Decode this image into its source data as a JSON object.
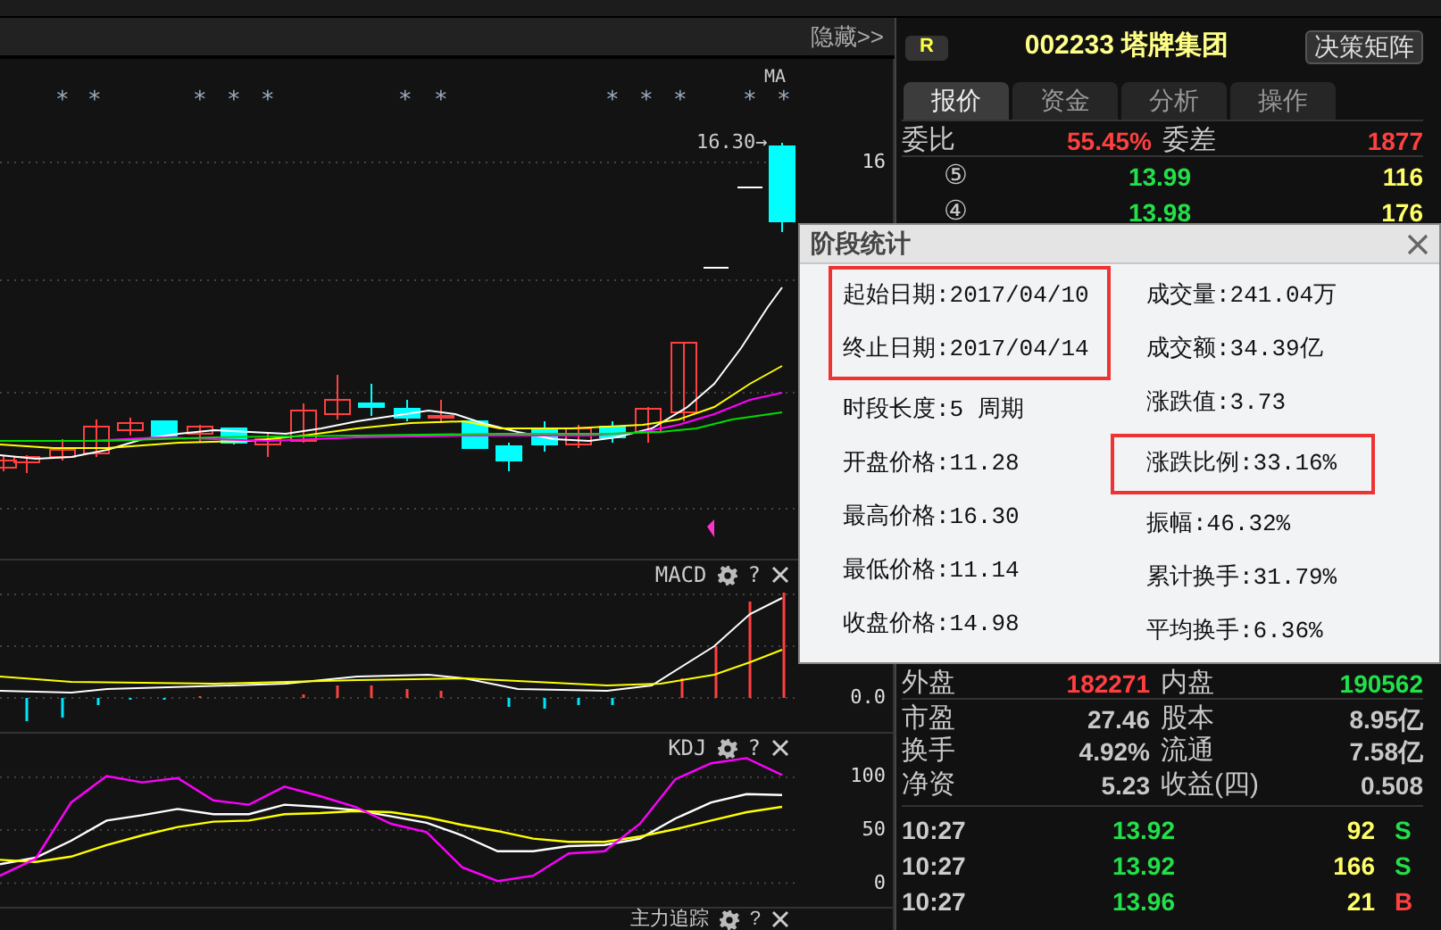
{
  "toolbar": {
    "hide_button": "隐藏>>"
  },
  "main_chart": {
    "signal_marks": [
      "*",
      "*",
      "*",
      "*",
      "*",
      "*",
      "*",
      "*",
      "*",
      "*",
      "*",
      "*"
    ],
    "legend": "MA",
    "price_tag": "16.30→",
    "axis_label": "16"
  },
  "macd": {
    "title": "MACD",
    "help": "?",
    "axis_label": "0.0"
  },
  "kdj": {
    "title": "KDJ",
    "help": "?",
    "chart_data": {
      "type": "line",
      "ylim": [
        -24,
        141
      ],
      "grid": true,
      "yticks": [
        0,
        50,
        100
      ],
      "series": [
        {
          "color": "#ffffff",
          "values": [
            18,
            24,
            40,
            59,
            64,
            70,
            65,
            65,
            74,
            72,
            69,
            63,
            57,
            45,
            30,
            30,
            35,
            36,
            42,
            61,
            76,
            84,
            83
          ]
        },
        {
          "color": "#ffff00",
          "values": [
            22,
            20,
            25,
            36,
            45,
            53,
            58,
            59,
            65,
            66,
            68,
            67,
            62,
            55,
            49,
            42,
            39,
            39,
            44,
            51,
            59,
            67,
            72
          ]
        },
        {
          "color": "#ff00ff",
          "values": [
            7,
            23,
            76,
            101,
            95,
            99,
            78,
            74,
            91,
            82,
            72,
            56,
            48,
            15,
            2,
            7,
            28,
            30,
            56,
            98,
            113,
            118,
            102
          ]
        }
      ]
    }
  },
  "bottom_panel": {
    "title": "主力追踪",
    "help": "?"
  },
  "header": {
    "badge": "R",
    "title": "002233 塔牌集团",
    "button": "决策矩阵"
  },
  "tabs": [
    {
      "label": "报价",
      "selected": true
    },
    {
      "label": "资金",
      "selected": false
    },
    {
      "label": "分析",
      "selected": false
    },
    {
      "label": "操作",
      "selected": false
    }
  ],
  "order_ratio": [
    {
      "label": "委比",
      "value": "55.45%"
    },
    {
      "label": "委差",
      "value": "1877"
    }
  ],
  "quotes": [
    {
      "level": "⑤",
      "price": "13.99",
      "volume": "116"
    },
    {
      "level": "④",
      "price": "13.98",
      "volume": "176"
    }
  ],
  "stats": [
    {
      "cells": [
        {
          "label": "外盘",
          "value": "182271"
        },
        {
          "label": "内盘",
          "value": "190562"
        }
      ]
    },
    {
      "cells": [
        {
          "label": "市盈",
          "value": "27.46"
        },
        {
          "label": "股本",
          "value": "8.95亿"
        }
      ]
    },
    {
      "cells": [
        {
          "label": "换手",
          "value": "4.92%"
        },
        {
          "label": "流通",
          "value": "7.58亿"
        }
      ]
    },
    {
      "cells": [
        {
          "label": "净资",
          "value": "5.23"
        },
        {
          "label": "收益(四)",
          "value": "0.508"
        }
      ]
    }
  ],
  "trades": [
    {
      "time": "10:27",
      "price": "13.92",
      "volume": "92",
      "side": "S",
      "kind": "sell"
    },
    {
      "time": "10:27",
      "price": "13.92",
      "volume": "166",
      "side": "S",
      "kind": "sell"
    },
    {
      "time": "10:27",
      "price": "13.96",
      "volume": "21",
      "side": "B",
      "kind": "buy"
    }
  ],
  "dialog": {
    "title": "阶段统计",
    "columns": [
      [
        {
          "text": "起始日期:2017/04/10",
          "highlighted": true
        },
        {
          "text": "终止日期:2017/04/14",
          "highlighted": true
        },
        {
          "text": "时段长度:5 周期",
          "highlighted": false
        },
        {
          "text": "开盘价格:11.28",
          "highlighted": false
        },
        {
          "text": "最高价格:16.30",
          "highlighted": false
        },
        {
          "text": "最低价格:11.14",
          "highlighted": false
        },
        {
          "text": "收盘价格:14.98",
          "highlighted": false
        }
      ],
      [
        {
          "text": "成交量:241.04万",
          "highlighted": false
        },
        {
          "text": "成交额:34.39亿",
          "highlighted": false
        },
        {
          "text": "涨跌值:3.73",
          "highlighted": false
        },
        {
          "text": "涨跌比例:33.16%",
          "highlighted": true
        },
        {
          "text": "振幅:46.32%",
          "highlighted": false
        },
        {
          "text": "累计换手:31.79%",
          "highlighted": false
        },
        {
          "text": "平均换手:6.36%",
          "highlighted": false
        }
      ]
    ]
  }
}
